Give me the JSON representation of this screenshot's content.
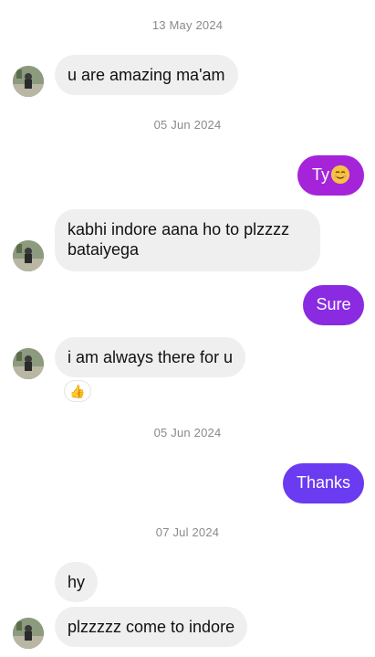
{
  "colors": {
    "incoming_bubble": "#efefef",
    "outgoing_purple": "#8a2be2",
    "outgoing_violet": "#6a3bf0",
    "date_text": "#8a8a8a"
  },
  "dates": {
    "d1": "13 May 2024",
    "d2": "05 Jun 2024",
    "d3": "05 Jun 2024",
    "d4": "07 Jul 2024"
  },
  "messages": {
    "m1": "u are amazing ma'am",
    "m2": "Ty",
    "m2_emoji": "smiling-face-emoji",
    "m3_line1": "kabhi indore aana ho to plzzzz",
    "m3_line2": "bataiyega",
    "m4": "Sure",
    "m5": "i am always there for u",
    "m5_reaction": "👍",
    "m6": "Thanks",
    "m7": "hy",
    "m8": "plzzzzz come to indore"
  }
}
